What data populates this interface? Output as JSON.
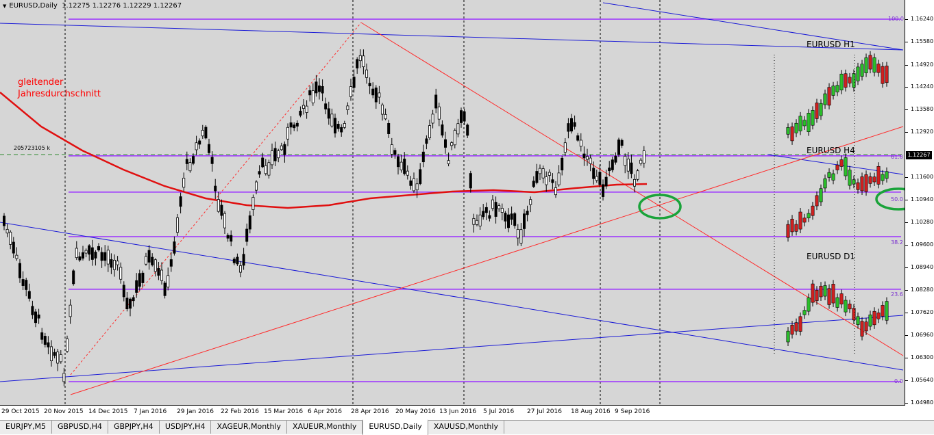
{
  "title": {
    "symbol": "EURUSD,Daily",
    "ohlc": "1.12275 1.12276 1.12229 1.12267"
  },
  "annotation": {
    "line1": "gleitender",
    "line2": "Jahresdurchschnitt"
  },
  "ghost_label": "205723105 k",
  "insets": {
    "h1": "EURUSD H1",
    "h4": "EURUSD H4",
    "d1": "EURUSD D1"
  },
  "fib_levels": {
    "l100": "100.0",
    "l618": "61.8",
    "l50": "50.0",
    "l382": "38.2",
    "l236": "23.6",
    "l0": "0.0"
  },
  "price_axis": [
    "1.16240",
    "1.15580",
    "1.14920",
    "1.14240",
    "1.13580",
    "1.12920",
    "1.11600",
    "1.10940",
    "1.10280",
    "1.09600",
    "1.08940",
    "1.08280",
    "1.07620",
    "1.06960",
    "1.06300",
    "1.05640",
    "1.04980"
  ],
  "current_price": "1.12267",
  "time_axis": [
    "29 Oct 2015",
    "20 Nov 2015",
    "14 Dec 2015",
    "7 Jan 2016",
    "29 Jan 2016",
    "22 Feb 2016",
    "15 Mar 2016",
    "6 Apr 2016",
    "28 Apr 2016",
    "20 May 2016",
    "13 Jun 2016",
    "5 Jul 2016",
    "27 Jul 2016",
    "18 Aug 2016",
    "9 Sep 2016"
  ],
  "tabs": [
    {
      "label": "EURJPY,M5",
      "active": false
    },
    {
      "label": "GBPUSD,H4",
      "active": false
    },
    {
      "label": "GBPJPY,H4",
      "active": false
    },
    {
      "label": "USDJPY,H4",
      "active": false
    },
    {
      "label": "XAGEUR,Monthly",
      "active": false
    },
    {
      "label": "XAUEUR,Monthly",
      "active": false
    },
    {
      "label": "EURUSD,Daily",
      "active": true
    },
    {
      "label": "XAUUSD,Monthly",
      "active": false
    }
  ],
  "colors": {
    "background": "#d6d6d6",
    "candle_up": "#ffffff",
    "candle_down": "#000000",
    "moving_average": "#e01010",
    "fib_lines": "#9b30ff",
    "trend_blue": "#1a1ad6",
    "trend_red": "#ff2a2a",
    "highlight_ellipse": "#1aa33a"
  },
  "chart_data": {
    "type": "candlestick",
    "symbol": "EURUSD",
    "timeframe": "Daily",
    "ylim": [
      1.0498,
      1.1624
    ],
    "fib_prices": {
      "100.0": 1.1614,
      "61.8": 1.1203,
      "50.0": 1.1094,
      "38.2": 1.096,
      "23.6": 1.0802,
      "0.0": 1.0524
    },
    "moving_average_path": [
      {
        "date": "29 Oct 2015",
        "price": 1.138
      },
      {
        "date": "20 Nov 2015",
        "price": 1.129
      },
      {
        "date": "14 Dec 2015",
        "price": 1.121
      },
      {
        "date": "7 Jan 2016",
        "price": 1.117
      },
      {
        "date": "29 Jan 2016",
        "price": 1.1125
      },
      {
        "date": "22 Feb 2016",
        "price": 1.1105
      },
      {
        "date": "15 Mar 2016",
        "price": 1.109
      },
      {
        "date": "6 Apr 2016",
        "price": 1.1095
      },
      {
        "date": "28 Apr 2016",
        "price": 1.1105
      },
      {
        "date": "20 May 2016",
        "price": 1.1123
      },
      {
        "date": "13 Jun 2016",
        "price": 1.1128
      },
      {
        "date": "5 Jul 2016",
        "price": 1.1133
      },
      {
        "date": "27 Jul 2016",
        "price": 1.1128
      },
      {
        "date": "18 Aug 2016",
        "price": 1.1138
      },
      {
        "date": "9 Sep 2016",
        "price": 1.115
      }
    ]
  }
}
